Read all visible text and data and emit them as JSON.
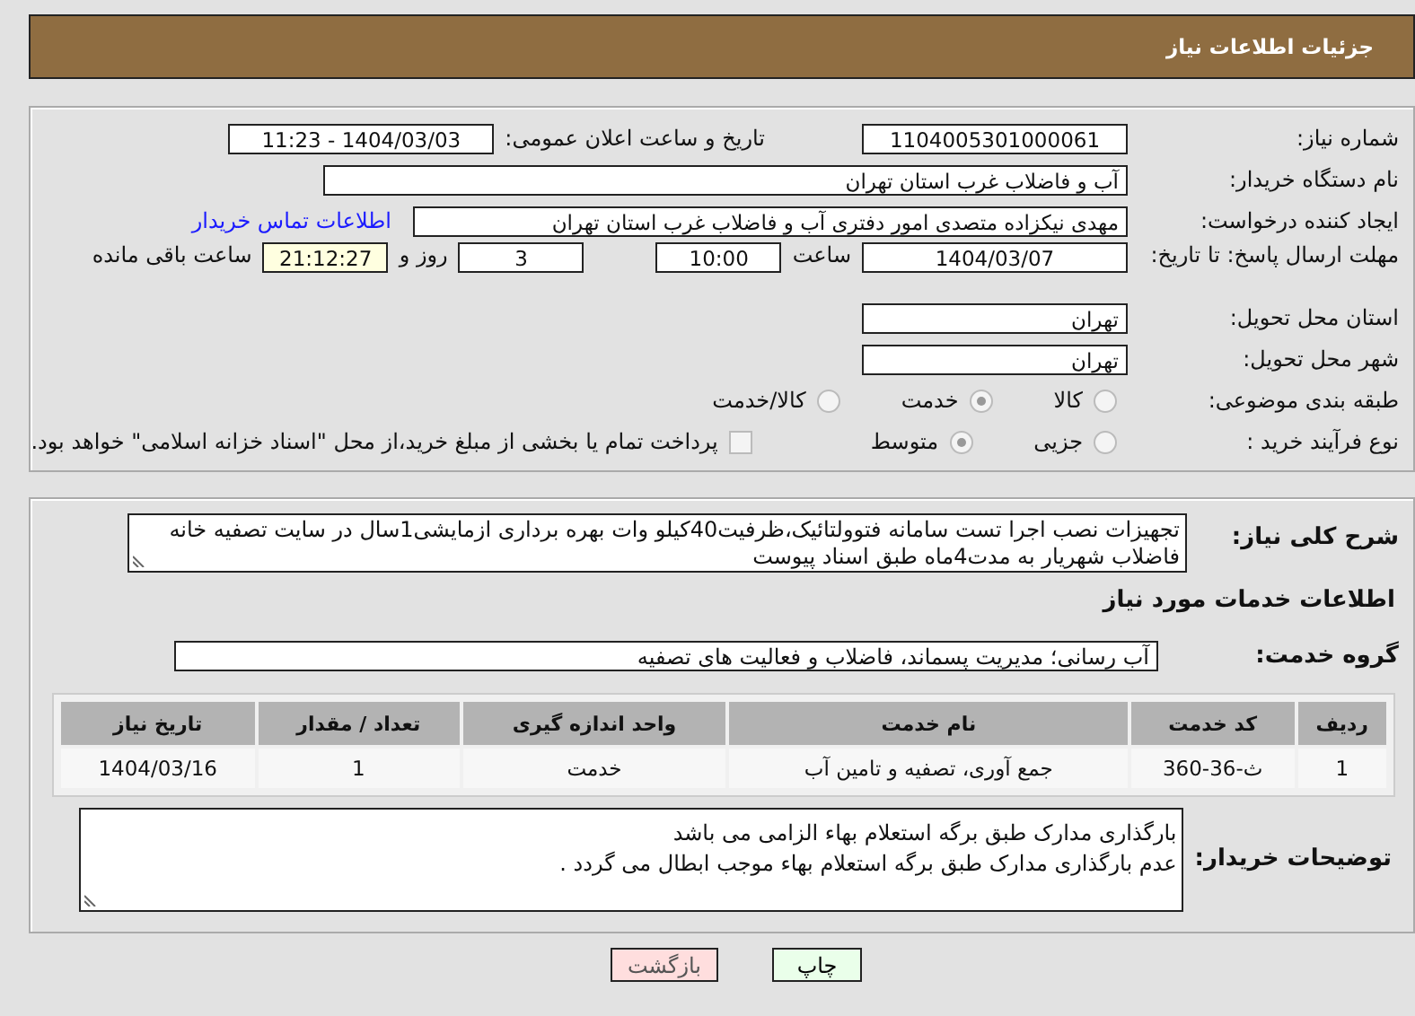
{
  "header": {
    "title": "جزئیات اطلاعات نیاز"
  },
  "details": {
    "need_number": {
      "label": "شماره نیاز:",
      "value": "1104005301000061"
    },
    "announce": {
      "label": "تاریخ و ساعت اعلان عمومی:",
      "value": "1404/03/03 - 11:23"
    },
    "buyer": {
      "label": "نام دستگاه خریدار:",
      "value": "آب و فاضلاب غرب استان تهران"
    },
    "requester": {
      "label": "ایجاد کننده درخواست:",
      "value": "مهدی نیکزاده متصدی امور دفتری آب و فاضلاب غرب استان تهران",
      "link": "اطلاعات تماس خریدار"
    },
    "deadline": {
      "label": "مهلت ارسال پاسخ: تا تاریخ:",
      "date": "1404/03/07",
      "time_label": "ساعت",
      "time": "10:00",
      "days": "3",
      "days_label": "روز و",
      "remaining": "21:12:27",
      "remaining_label": "ساعت باقی مانده"
    },
    "province": {
      "label": "استان محل تحویل:",
      "value": "تهران"
    },
    "city": {
      "label": "شهر محل تحویل:",
      "value": "تهران"
    },
    "category": {
      "label": "طبقه بندی موضوعی:",
      "options": [
        {
          "label": "کالا",
          "selected": false
        },
        {
          "label": "خدمت",
          "selected": true
        },
        {
          "label": "کالا/خدمت",
          "selected": false
        }
      ]
    },
    "process": {
      "label": "نوع فرآیند خرید :",
      "options": [
        {
          "label": "جزیی",
          "selected": false
        },
        {
          "label": "متوسط",
          "selected": true
        }
      ],
      "payment": {
        "checked": false,
        "text": "پرداخت تمام یا بخشی از مبلغ خرید،از محل \"اسناد خزانه اسلامی\" خواهد بود."
      }
    }
  },
  "description": {
    "label": "شرح کلی نیاز:",
    "value": "تجهیزات نصب اجرا تست سامانه فتوولتائیک،ظرفیت40کیلو وات بهره برداری ازمایشی1سال در سایت تصفیه خانه فاضلاب شهریار به مدت4ماه طبق اسناد پیوست"
  },
  "services_title": "اطلاعات خدمات مورد نیاز",
  "service_group": {
    "label": "گروه خدمت:",
    "value": "آب رسانی؛ مدیریت پسماند، فاضلاب و فعالیت های تصفیه"
  },
  "table": {
    "columns": [
      "ردیف",
      "کد خدمت",
      "نام خدمت",
      "واحد اندازه گیری",
      "تعداد / مقدار",
      "تاریخ نیاز"
    ],
    "rows": [
      [
        "1",
        "ث-36-360",
        "جمع آوری، تصفیه و تامین آب",
        "خدمت",
        "1",
        "1404/03/16"
      ]
    ]
  },
  "buyer_notes": {
    "label": "توضیحات خریدار:",
    "lines": [
      "بارگذاری مدارک طبق برگه استعلام بهاء الزامی می باشد",
      "عدم بارگذاری مدارک طبق برگه استعلام بهاء موجب ابطال می گردد ."
    ]
  },
  "buttons": [
    {
      "label": "چاپ",
      "kind": "print"
    },
    {
      "label": "بازگشت",
      "kind": "back"
    }
  ]
}
